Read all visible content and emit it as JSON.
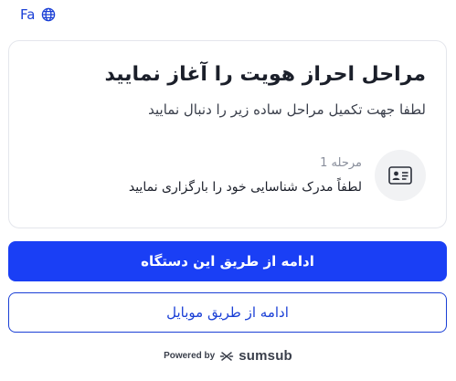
{
  "language": {
    "code": "Fa",
    "icon": "globe-icon"
  },
  "card": {
    "title": "مراحل احراز هویت را آغاز نمایید",
    "subtitle": "لطفا جهت تکمیل مراحل ساده زیر را دنبال نمایید",
    "steps": [
      {
        "label": "مرحله 1",
        "text": "لطفاً مدرک شناسایی خود را بارگزاری نمایید",
        "icon": "id-card-icon"
      }
    ]
  },
  "buttons": {
    "primary_label": "ادامه از طریق این دستگاه",
    "secondary_label": "ادامه از طریق موبایل"
  },
  "footer": {
    "powered_by": "Powered by",
    "brand": "sumsub",
    "brand_icon": "sumsub-logo-icon"
  },
  "colors": {
    "accent": "#1a3ff5",
    "link": "#1a3fd6",
    "card_border": "#e4e6ec",
    "icon_bg": "#f1f2f4"
  }
}
